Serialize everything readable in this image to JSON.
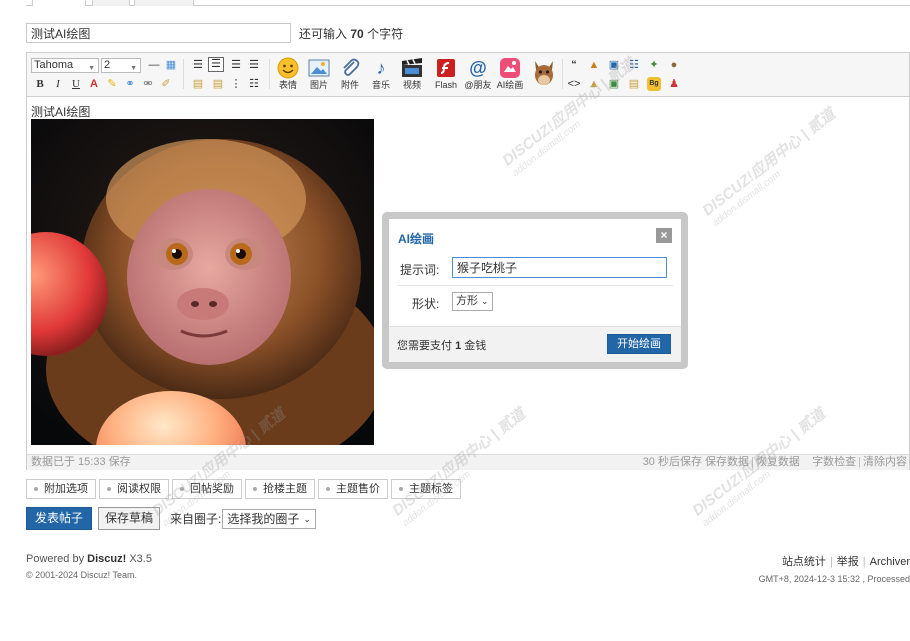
{
  "subject": {
    "value": "测试AI绘图",
    "remain_prefix": "还可输入",
    "remain_count": "70",
    "remain_suffix": "个字符"
  },
  "toolbar": {
    "font": "Tahoma",
    "size": "2",
    "buttons": [
      {
        "label": "表情",
        "icon": "smiley-icon"
      },
      {
        "label": "图片",
        "icon": "image-icon"
      },
      {
        "label": "附件",
        "icon": "paperclip-icon"
      },
      {
        "label": "音乐",
        "icon": "music-note-icon"
      },
      {
        "label": "视频",
        "icon": "clapperboard-icon"
      },
      {
        "label": "Flash",
        "icon": "flash-icon"
      },
      {
        "label": "@朋友",
        "icon": "at-icon"
      },
      {
        "label": "AI绘画",
        "icon": "ai-paint-icon"
      }
    ],
    "bold": "B",
    "italic": "I",
    "underline": "U"
  },
  "content": {
    "title": "测试AI绘图",
    "image_icon": "monkey-photo"
  },
  "status": {
    "saved_text": "数据已于 15:33 保存",
    "autosave": "30 秒后保存",
    "save_data": "保存数据",
    "restore_data": "恢复数据",
    "word_check": "字数检查",
    "clear_content": "清除内容"
  },
  "extensions": [
    "附加选项",
    "阅读权限",
    "回帖奖励",
    "抢楼主题",
    "主题售价",
    "主题标签"
  ],
  "actions": {
    "publish": "发表帖子",
    "save_draft": "保存草稿",
    "circle_label": "来自圈子:",
    "circle_select": "选择我的圈子"
  },
  "dialog": {
    "title": "AI绘画",
    "close": "×",
    "prompt_label": "提示词:",
    "prompt_value": "猴子吃桃子",
    "shape_label": "形状:",
    "shape_value": "方形",
    "pay_prefix": "您需要支付",
    "pay_amount": "1",
    "pay_suffix": "金钱",
    "start_button": "开始绘画"
  },
  "footer": {
    "powered_prefix": "Powered by",
    "brand": "Discuz!",
    "version": "X3.5",
    "copyright": "© 2001-2024 Discuz! Team.",
    "links": [
      "站点统计",
      "举报",
      "Archiver"
    ],
    "time_info": "GMT+8, 2024-12-3 15:32 , Processed"
  },
  "watermark": {
    "brand": "DISCUZ!应用中心",
    "sub": "addon.dismall.com",
    "tail": "贰道"
  }
}
